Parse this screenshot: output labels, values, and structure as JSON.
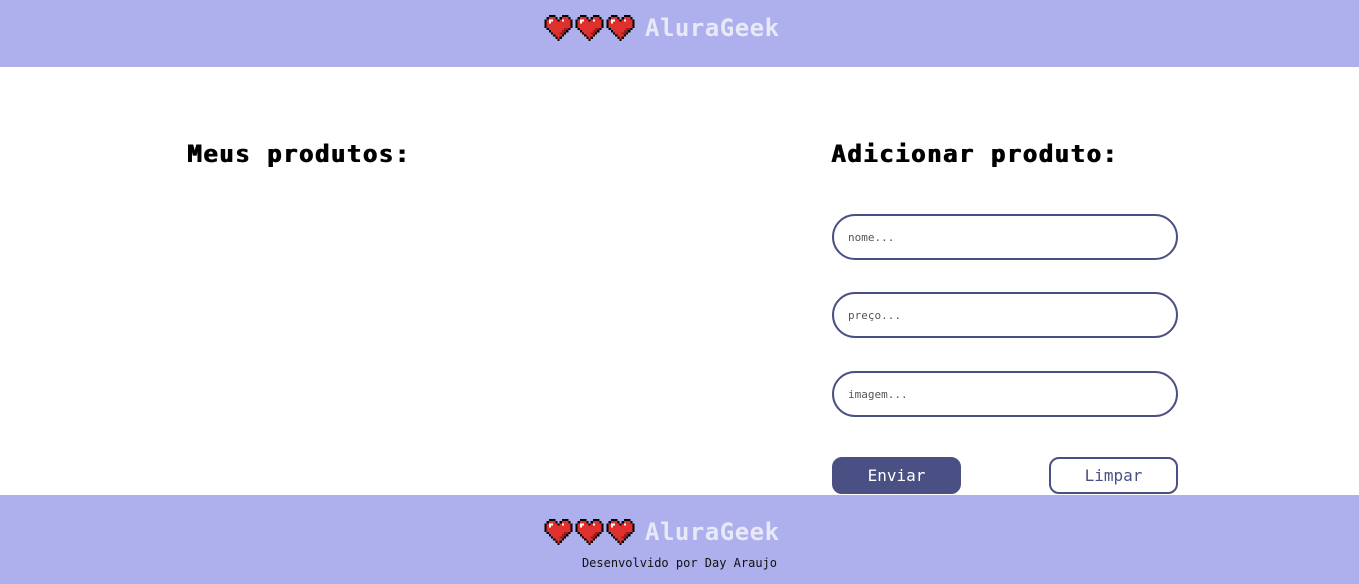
{
  "header": {
    "logo_text": "AluraGeek",
    "logo_icons": [
      "heart-icon",
      "heart-icon",
      "heart-icon"
    ]
  },
  "products": {
    "title": "Meus produtos:"
  },
  "form": {
    "title": "Adicionar produto:",
    "name_placeholder": "nome...",
    "price_placeholder": "preço...",
    "image_placeholder": "imagem...",
    "send_label": "Enviar",
    "clear_label": "Limpar"
  },
  "footer": {
    "logo_text": "AluraGeek",
    "credit": "Desenvolvido por Day Araujo"
  },
  "colors": {
    "bar_background": "#aeb0ee",
    "accent": "#4a5083",
    "heart": "#e0302e"
  }
}
